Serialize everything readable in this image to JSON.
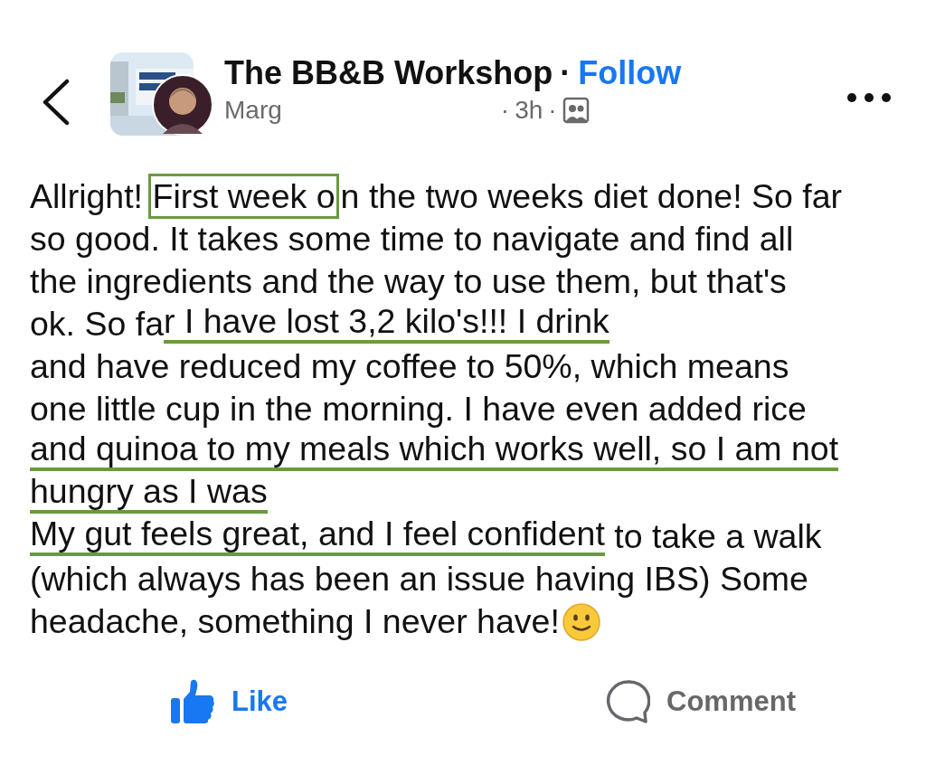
{
  "header": {
    "page_name": "The BB&B Workshop",
    "separator": "·",
    "follow": "Follow",
    "author": "Marg",
    "time_separator": "·",
    "time": "3h",
    "time_separator_2": "·"
  },
  "post": {
    "lines": [
      [
        {
          "text": "Allright! "
        },
        {
          "text": "First week o",
          "kind": "box"
        },
        {
          "text": "n the two weeks diet done! So far"
        }
      ],
      [
        {
          "text": "so good. It takes some time to navigate and find all"
        }
      ],
      [
        {
          "text": "the ingredients and the way to use them, but that's"
        }
      ],
      [
        {
          "text": "ok. So fa"
        },
        {
          "text": "r I have lost 3,2 kilo's!!! I drink",
          "kind": "underline"
        }
      ],
      [
        {
          "text": "and have reduced my coffee to 50%, which means"
        }
      ],
      [
        {
          "text": "one little cup in the morning. I have even added rice"
        }
      ],
      [
        {
          "text": "and quinoa to my meals which works well, so I am not",
          "kind": "underline"
        }
      ],
      [
        {
          "text": "hungry as I was",
          "kind": "underline"
        }
      ],
      [
        {
          "text": "My gut feels great, and I feel confident",
          "kind": "underline"
        },
        {
          "text": " to take a walk"
        }
      ],
      [
        {
          "text": "(which always has been an issue having IBS) Some"
        }
      ],
      [
        {
          "text": "headache, something I never have!"
        },
        {
          "kind": "smiley"
        }
      ]
    ]
  },
  "actions": [
    {
      "label": "Like",
      "kind": "like"
    },
    {
      "label": "Comment",
      "kind": "comment"
    }
  ]
}
